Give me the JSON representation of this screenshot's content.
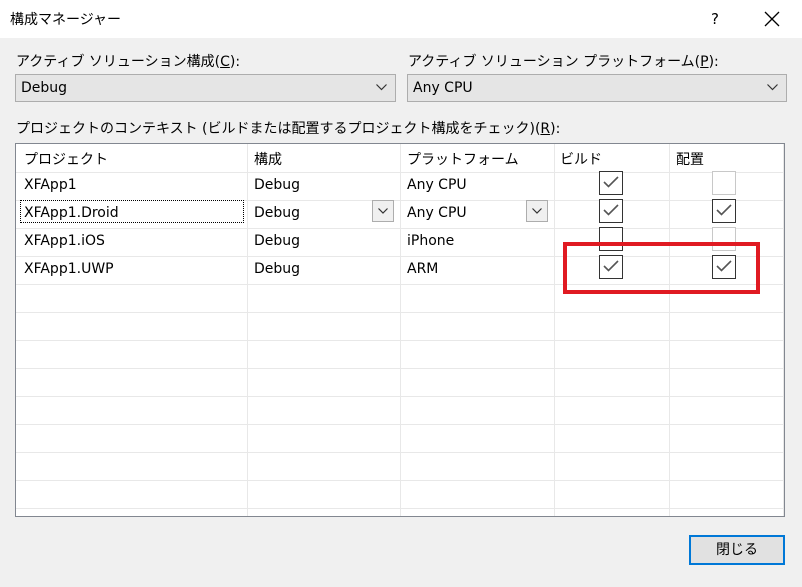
{
  "window": {
    "title": "構成マネージャー",
    "help_label": "?"
  },
  "solution_config": {
    "label_prefix": "アクティブ ソリューション構成(",
    "label_key": "C",
    "label_suffix": "):",
    "value": "Debug"
  },
  "solution_platform": {
    "label_prefix": "アクティブ ソリューション プラットフォーム(",
    "label_key": "P",
    "label_suffix": "):",
    "value": "Any CPU"
  },
  "contexts": {
    "label_prefix": "プロジェクトのコンテキスト (ビルドまたは配置するプロジェクト構成をチェック)(",
    "label_key": "R",
    "label_suffix": "):",
    "columns": [
      "プロジェクト",
      "構成",
      "プラットフォーム",
      "ビルド",
      "配置"
    ],
    "rows": [
      {
        "project": "XFApp1",
        "config": "Debug",
        "platform": "Any CPU",
        "build": true,
        "deploy": false,
        "deploy_enabled": true
      },
      {
        "project": "XFApp1.Droid",
        "config": "Debug",
        "platform": "Any CPU",
        "build": true,
        "deploy": true,
        "deploy_enabled": true
      },
      {
        "project": "XFApp1.iOS",
        "config": "Debug",
        "platform": "iPhone",
        "build": false,
        "deploy": false,
        "deploy_enabled": false
      },
      {
        "project": "XFApp1.UWP",
        "config": "Debug",
        "platform": "ARM",
        "build": true,
        "deploy": true,
        "deploy_enabled": true
      }
    ]
  },
  "footer": {
    "close_label": "閉じる"
  },
  "colors": {
    "accent": "#0078d7",
    "highlight": "#e01a22"
  }
}
